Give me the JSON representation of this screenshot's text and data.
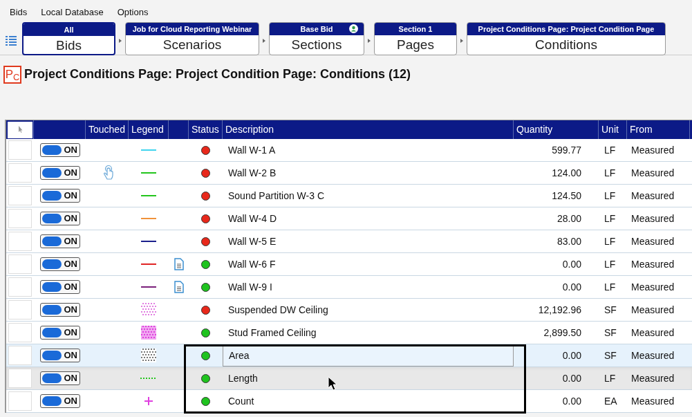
{
  "menu": [
    "Bids",
    "Local Database",
    "Options"
  ],
  "breadcrumbs": [
    {
      "top": "All",
      "bottom": "Bids",
      "selected": true,
      "user_badge": false
    },
    {
      "top": "Job for Cloud Reporting Webinar",
      "bottom": "Scenarios",
      "selected": false,
      "user_badge": false
    },
    {
      "top": "Base Bid",
      "bottom": "Sections",
      "selected": false,
      "user_badge": true
    },
    {
      "top": "Section 1",
      "bottom": "Pages",
      "selected": false,
      "user_badge": false
    },
    {
      "top": "Project Conditions Page: Project Condition Page",
      "bottom": "Conditions",
      "selected": false,
      "user_badge": false
    }
  ],
  "page_title": {
    "badge": "P$_{C}$",
    "text": "Project Conditions Page: Project Condition Page: Conditions (12)"
  },
  "table": {
    "columns": [
      "",
      "Touched",
      "Legend",
      "",
      "Status",
      "Description",
      "Quantity",
      "Unit",
      "From"
    ],
    "rows": [
      {
        "toggle_label": "ON",
        "on": true,
        "touched": false,
        "legend": {
          "kind": "line",
          "color": "#3fd4ee"
        },
        "note": false,
        "status": {
          "color": "#e8281b"
        },
        "description": "Wall W-1 A",
        "quantity": "599.77",
        "unit": "LF",
        "from": "Measured",
        "selected": false,
        "hovered": false
      },
      {
        "toggle_label": "ON",
        "on": true,
        "touched": true,
        "legend": {
          "kind": "line",
          "color": "#22c51c"
        },
        "note": false,
        "status": {
          "color": "#e8281b"
        },
        "description": "Wall W-2 B",
        "quantity": "124.00",
        "unit": "LF",
        "from": "Measured",
        "selected": false,
        "hovered": false
      },
      {
        "toggle_label": "ON",
        "on": true,
        "touched": false,
        "legend": {
          "kind": "line",
          "color": "#22c51c"
        },
        "note": false,
        "status": {
          "color": "#e8281b"
        },
        "description": "Sound Partition W-3 C",
        "quantity": "124.50",
        "unit": "LF",
        "from": "Measured",
        "selected": false,
        "hovered": false
      },
      {
        "toggle_label": "ON",
        "on": true,
        "touched": false,
        "legend": {
          "kind": "line",
          "color": "#f0923a"
        },
        "note": false,
        "status": {
          "color": "#e8281b"
        },
        "description": "Wall W-4 D",
        "quantity": "28.00",
        "unit": "LF",
        "from": "Measured",
        "selected": false,
        "hovered": false
      },
      {
        "toggle_label": "ON",
        "on": true,
        "touched": false,
        "legend": {
          "kind": "line",
          "color": "#1a1f8c"
        },
        "note": false,
        "status": {
          "color": "#e8281b"
        },
        "description": "Wall W-5 E",
        "quantity": "83.00",
        "unit": "LF",
        "from": "Measured",
        "selected": false,
        "hovered": false
      },
      {
        "toggle_label": "ON",
        "on": true,
        "touched": false,
        "legend": {
          "kind": "line",
          "color": "#e02424"
        },
        "note": true,
        "status": {
          "color": "#1fc31f"
        },
        "description": "Wall W-6 F",
        "quantity": "0.00",
        "unit": "LF",
        "from": "Measured",
        "selected": false,
        "hovered": false
      },
      {
        "toggle_label": "ON",
        "on": true,
        "touched": false,
        "legend": {
          "kind": "line",
          "color": "#7a1f7a"
        },
        "note": true,
        "status": {
          "color": "#1fc31f"
        },
        "description": "Wall W-9 I",
        "quantity": "0.00",
        "unit": "LF",
        "from": "Measured",
        "selected": false,
        "hovered": false
      },
      {
        "toggle_label": "ON",
        "on": true,
        "touched": false,
        "legend": {
          "kind": "light-hatch",
          "color": "#e27de2"
        },
        "note": false,
        "status": {
          "color": "#e8281b"
        },
        "description": "Suspended DW Ceiling",
        "quantity": "12,192.96",
        "unit": "SF",
        "from": "Measured",
        "selected": false,
        "hovered": false
      },
      {
        "toggle_label": "ON",
        "on": true,
        "touched": false,
        "legend": {
          "kind": "dense-hatch",
          "color": "#e040e0"
        },
        "note": false,
        "status": {
          "color": "#1fc31f"
        },
        "description": "Stud Framed Ceiling",
        "quantity": "2,899.50",
        "unit": "SF",
        "from": "Measured",
        "selected": false,
        "hovered": false
      },
      {
        "toggle_label": "ON",
        "on": true,
        "touched": false,
        "legend": {
          "kind": "light-hatch",
          "color": "#777777"
        },
        "note": false,
        "status": {
          "color": "#1fc31f"
        },
        "description": "Area",
        "quantity": "0.00",
        "unit": "SF",
        "from": "Measured",
        "selected": true,
        "hovered": false
      },
      {
        "toggle_label": "ON",
        "on": true,
        "touched": false,
        "legend": {
          "kind": "dotted-line",
          "color": "#22c51c"
        },
        "note": false,
        "status": {
          "color": "#1fc31f"
        },
        "description": "Length",
        "quantity": "0.00",
        "unit": "LF",
        "from": "Measured",
        "selected": false,
        "hovered": true
      },
      {
        "toggle_label": "ON",
        "on": true,
        "touched": false,
        "legend": {
          "kind": "plus",
          "color": "#e040e0"
        },
        "note": false,
        "status": {
          "color": "#1fc31f"
        },
        "description": "Count",
        "quantity": "0.00",
        "unit": "EA",
        "from": "Measured",
        "selected": false,
        "hovered": false
      }
    ]
  }
}
